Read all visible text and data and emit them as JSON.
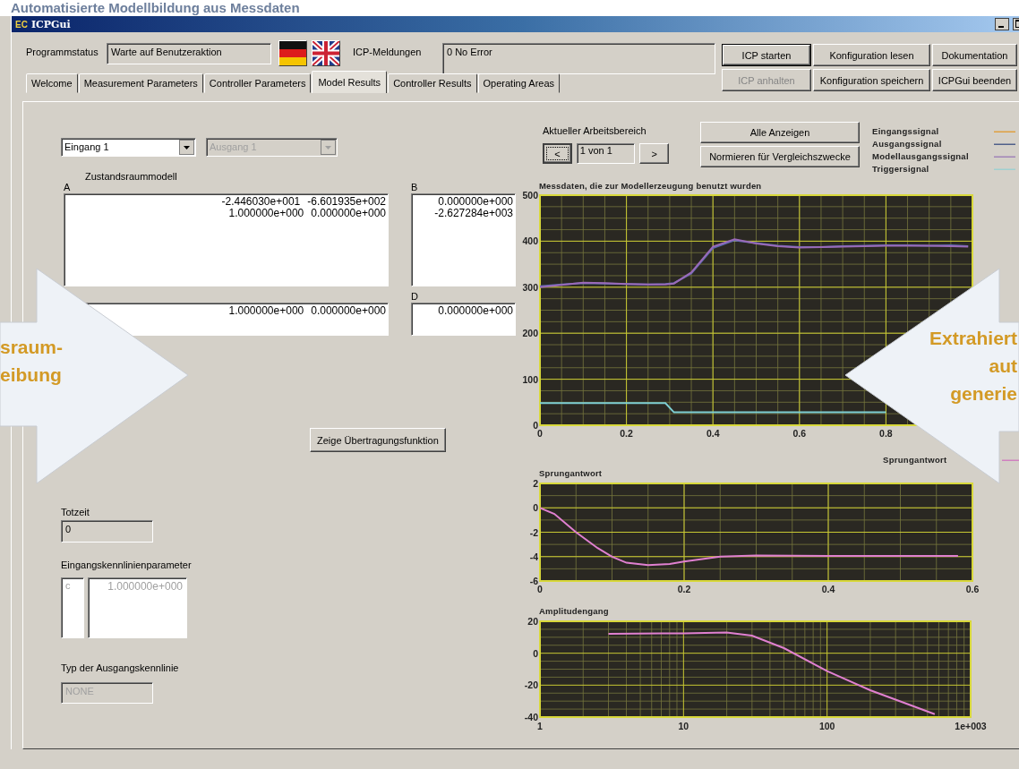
{
  "heading": "Automatisierte Modellbildung aus Messdaten",
  "window": {
    "logo": "EC",
    "title": "ICPGui"
  },
  "status": {
    "label": "Programmstatus",
    "value": "Warte auf Benutzeraktion"
  },
  "languages": [
    {
      "kind": "de"
    },
    {
      "kind": "uk"
    }
  ],
  "messages": {
    "label": "ICP-Meldungen",
    "value": "0 No Error"
  },
  "buttons": [
    {
      "label": "ICP starten",
      "disabled": false,
      "default": true
    },
    {
      "label": "Konfiguration lesen",
      "disabled": false,
      "default": false
    },
    {
      "label": "Dokumentation",
      "disabled": false,
      "default": false
    },
    {
      "label": "ICP anhalten",
      "disabled": true,
      "default": false
    },
    {
      "label": "Konfiguration speichern",
      "disabled": false,
      "default": false
    },
    {
      "label": "ICPGui beenden",
      "disabled": false,
      "default": false
    }
  ],
  "tabs": [
    {
      "label": "Welcome",
      "selected": false
    },
    {
      "label": "Measurement Parameters",
      "selected": false
    },
    {
      "label": "Controller Parameters",
      "selected": false
    },
    {
      "label": "Model Results",
      "selected": true
    },
    {
      "label": "Controller Results",
      "selected": false
    },
    {
      "label": "Operating Areas",
      "selected": false
    }
  ],
  "selectors": [
    {
      "value": "Eingang 1",
      "disabled": false
    },
    {
      "value": "Ausgang 1",
      "disabled": true
    }
  ],
  "model_label": "Zustandsraummodell",
  "matrix_rows": [
    {
      "matrices": [
        {
          "label": "A",
          "rows": [
            [
              "-2.446030e+001",
              "-6.601935e+002"
            ],
            [
              "1.000000e+000",
              "0.000000e+000"
            ]
          ]
        },
        {
          "label": "B",
          "rows": [
            [
              "0.000000e+000"
            ],
            [
              "-2.627284e+003"
            ]
          ]
        }
      ]
    },
    {
      "matrices": [
        {
          "rows": [
            [
              "1.000000e+000",
              "0.000000e+000"
            ]
          ]
        },
        {
          "label": "D",
          "rows": [
            [
              "0.000000e+000"
            ]
          ]
        }
      ]
    }
  ],
  "transfer_button": "Zeige Übertragungsfunktion",
  "dead_time": {
    "label": "Totzeit",
    "value": "0"
  },
  "input_params": {
    "label": "Eingangskennlinienparameter",
    "names": [
      "c"
    ],
    "values": [
      "1.000000e+000"
    ],
    "disabled": true
  },
  "output_type": {
    "label": "Typ der Ausgangskennlinie",
    "value": "NONE",
    "disabled": true
  },
  "range": {
    "label": "Aktueller Arbeitsbereich",
    "prev": {
      "text": "<",
      "focused": true
    },
    "value": "1 von 1",
    "next": {
      "text": ">",
      "focused": false
    }
  },
  "view_buttons": [
    "Alle Anzeigen",
    "Normieren für Vergleichszwecke"
  ],
  "legend": [
    {
      "label": "Eingangssignal",
      "color": "#e0a040"
    },
    {
      "label": "Ausgangssignal",
      "color": "#50608a"
    },
    {
      "label": "Modellausgangssignal",
      "color": "#a084b8"
    },
    {
      "label": "Triggersignal",
      "color": "#9fd0d0"
    }
  ],
  "charts": [
    {
      "chart_data": {
        "type": "line",
        "title": "Messdaten, die zur Modellerzeugung benutzt wurden",
        "x": [
          0,
          0.05,
          0.1,
          0.15,
          0.2,
          0.25,
          0.29,
          0.31,
          0.35,
          0.4,
          0.45,
          0.5,
          0.55,
          0.6,
          0.65,
          0.7,
          0.75,
          0.8,
          0.85,
          0.9,
          0.95,
          0.99
        ],
        "xlim": [
          0,
          1
        ],
        "ylim": [
          0,
          500
        ],
        "xticks": [
          0,
          0.2,
          0.4,
          0.6,
          0.8
        ],
        "yticks": [
          0,
          100,
          200,
          300,
          400,
          500
        ],
        "grid": true,
        "series": [
          {
            "color": "#5a6ab0",
            "values": [
              302,
              306,
              309,
              308,
              307,
              306,
              307,
              309,
              330,
              385,
              402,
              396,
              390,
              387,
              387,
              389,
              390,
              391,
              391,
              390,
              391,
              389
            ]
          },
          {
            "color": "#9a6ab8",
            "values": [
              300,
              305,
              310,
              309,
              307,
              306,
              306,
              308,
              332,
              388,
              404,
              395,
              389,
              386,
              387,
              388,
              389,
              390,
              390,
              390,
              389,
              388
            ]
          },
          {
            "color": "#7ecfd4",
            "values": [
              48,
              48,
              48,
              48,
              48,
              48,
              48,
              28,
              28,
              28,
              28,
              28,
              28,
              28,
              28,
              28,
              28,
              28,
              null,
              null,
              null,
              null
            ]
          }
        ]
      }
    },
    {
      "legend": {
        "label": "Sprungantwort",
        "color": "#d080c0"
      },
      "chart_data": {
        "type": "line",
        "title": "Sprungantwort",
        "x": [
          0,
          0.02,
          0.05,
          0.08,
          0.1,
          0.12,
          0.15,
          0.18,
          0.2,
          0.25,
          0.3,
          0.4,
          0.5,
          0.58
        ],
        "xlim": [
          0,
          0.6
        ],
        "ylim": [
          -6,
          2
        ],
        "xticks": [
          0,
          0.2,
          0.4,
          0.6
        ],
        "yticks": [
          -6,
          -4,
          -2,
          0,
          2
        ],
        "grid": true,
        "series": [
          {
            "color": "#e080d0",
            "values": [
              0,
              -0.5,
              -2,
              -3.3,
              -4,
              -4.5,
              -4.7,
              -4.6,
              -4.4,
              -4,
              -3.9,
              -3.95,
              -3.95,
              -3.95
            ]
          }
        ]
      }
    }
  ],
  "magnitude_plot": {
    "title": "Amplitudengang",
    "y_labels": [
      "20",
      "0",
      "-20",
      "-40"
    ],
    "x_labels": [
      "1",
      "10",
      "100",
      "1e+003"
    ]
  },
  "callouts": [
    {
      "lines": [
        "sraum-",
        "eibung"
      ]
    },
    {
      "lines": [
        "Extrahiert",
        "aut",
        "generie"
      ]
    }
  ]
}
